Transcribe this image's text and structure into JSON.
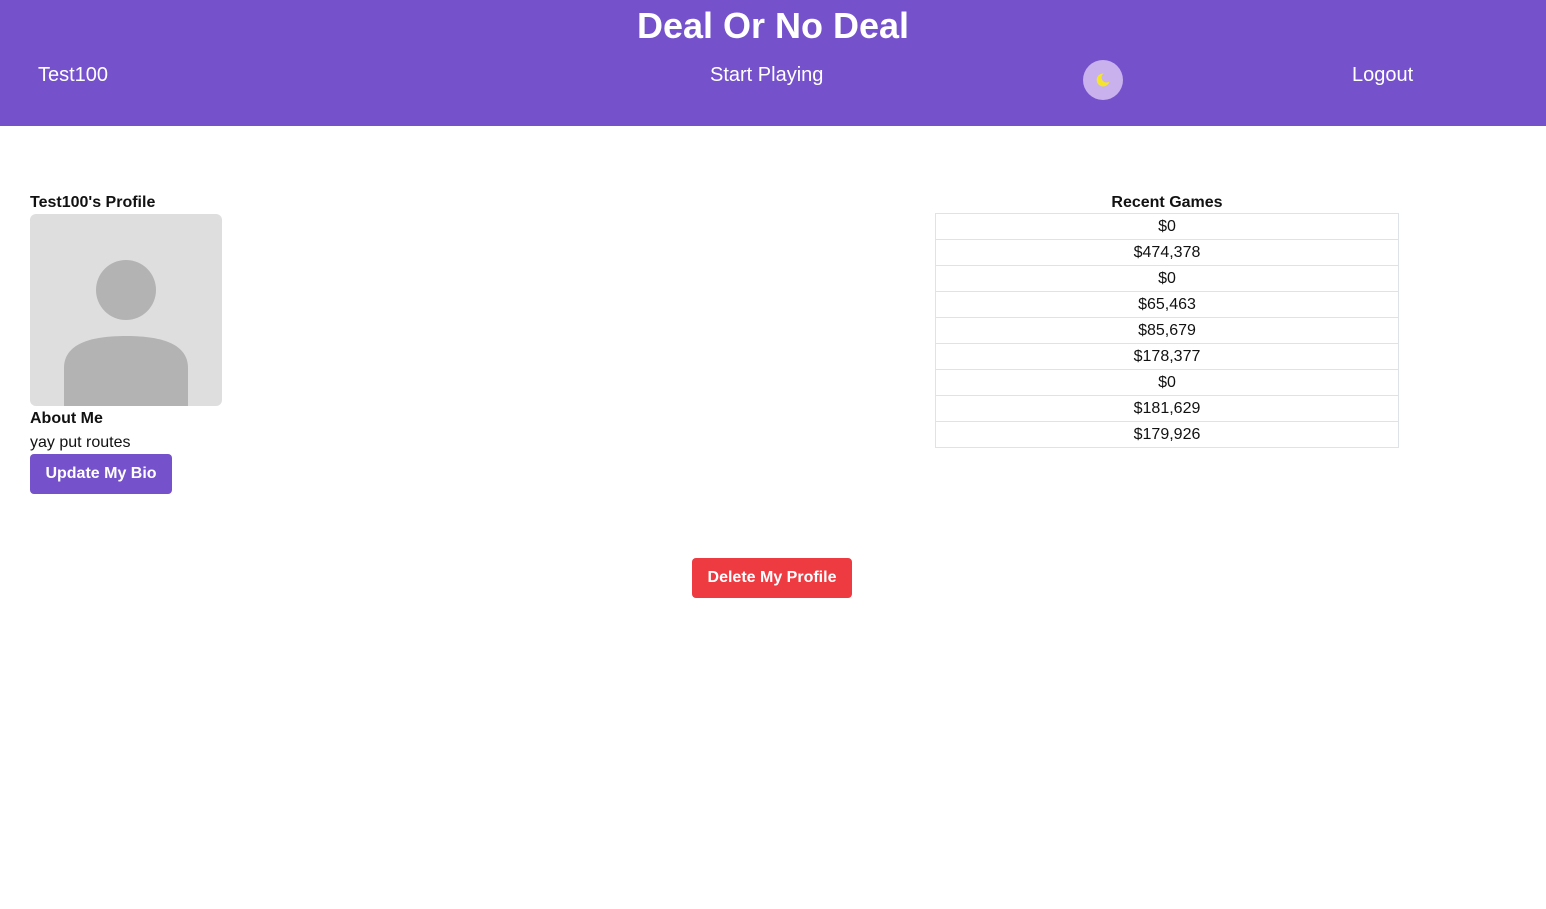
{
  "header": {
    "title": "Deal Or No Deal",
    "username": "Test100",
    "start_label": "Start Playing",
    "logout_label": "Logout",
    "theme_icon": "moon-icon"
  },
  "profile": {
    "heading": "Test100's Profile",
    "avatar_icon": "user-placeholder-icon",
    "about_heading": "About Me",
    "about_text": "yay put routes",
    "update_bio_label": "Update My Bio",
    "delete_label": "Delete My Profile"
  },
  "recent_games": {
    "title": "Recent Games",
    "results": [
      "$0",
      "$474,378",
      "$0",
      "$65,463",
      "$85,679",
      "$178,377",
      "$0",
      "$181,629",
      "$179,926"
    ]
  },
  "colors": {
    "brand": "#7551cc",
    "danger": "#ee3a41",
    "toggle_bg": "#c9b1ee",
    "moon": "#f5e52a"
  }
}
